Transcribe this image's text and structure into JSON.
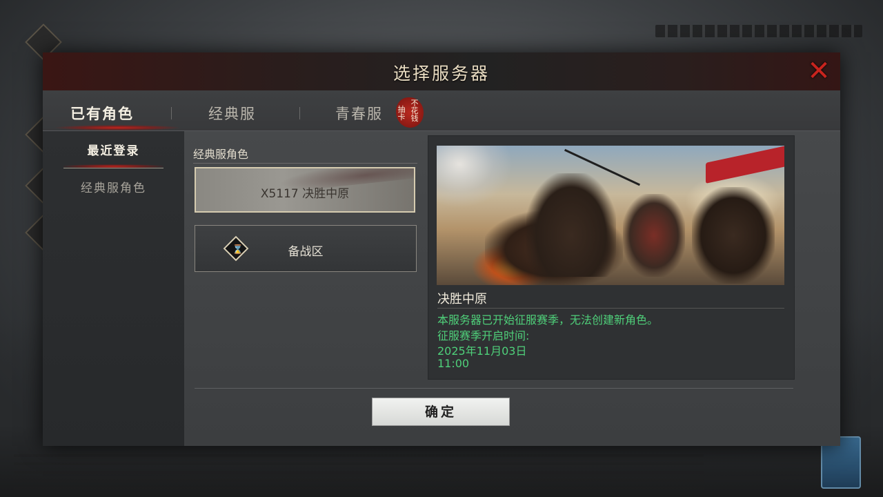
{
  "dialog": {
    "title": "选择服务器",
    "close_icon": "close-x-icon"
  },
  "tabs": [
    {
      "label": "已有角色",
      "active": true
    },
    {
      "label": "经典服",
      "active": false
    },
    {
      "label": "青春服",
      "active": false
    }
  ],
  "seal": {
    "line1": "抽卡",
    "line2": "不花钱"
  },
  "sidebar": {
    "items": [
      {
        "label": "最近登录",
        "active": true
      },
      {
        "label": "经典服角色",
        "active": false
      }
    ]
  },
  "list": {
    "header": "经典服角色",
    "server": {
      "label": "X5117 决胜中原"
    },
    "prep": {
      "label": "备战区",
      "icon": "hourglass-icon"
    }
  },
  "detail": {
    "title": "决胜中原",
    "lines": [
      "本服务器已开始征服赛季，无法创建新角色。",
      "征服赛季开启时间:",
      "2025年11月03日",
      "11:00"
    ],
    "text_color": "#4fd07a"
  },
  "confirm_label": "确定",
  "colors": {
    "accent_red": "#c0231c",
    "title_text": "#e9dcc2"
  }
}
